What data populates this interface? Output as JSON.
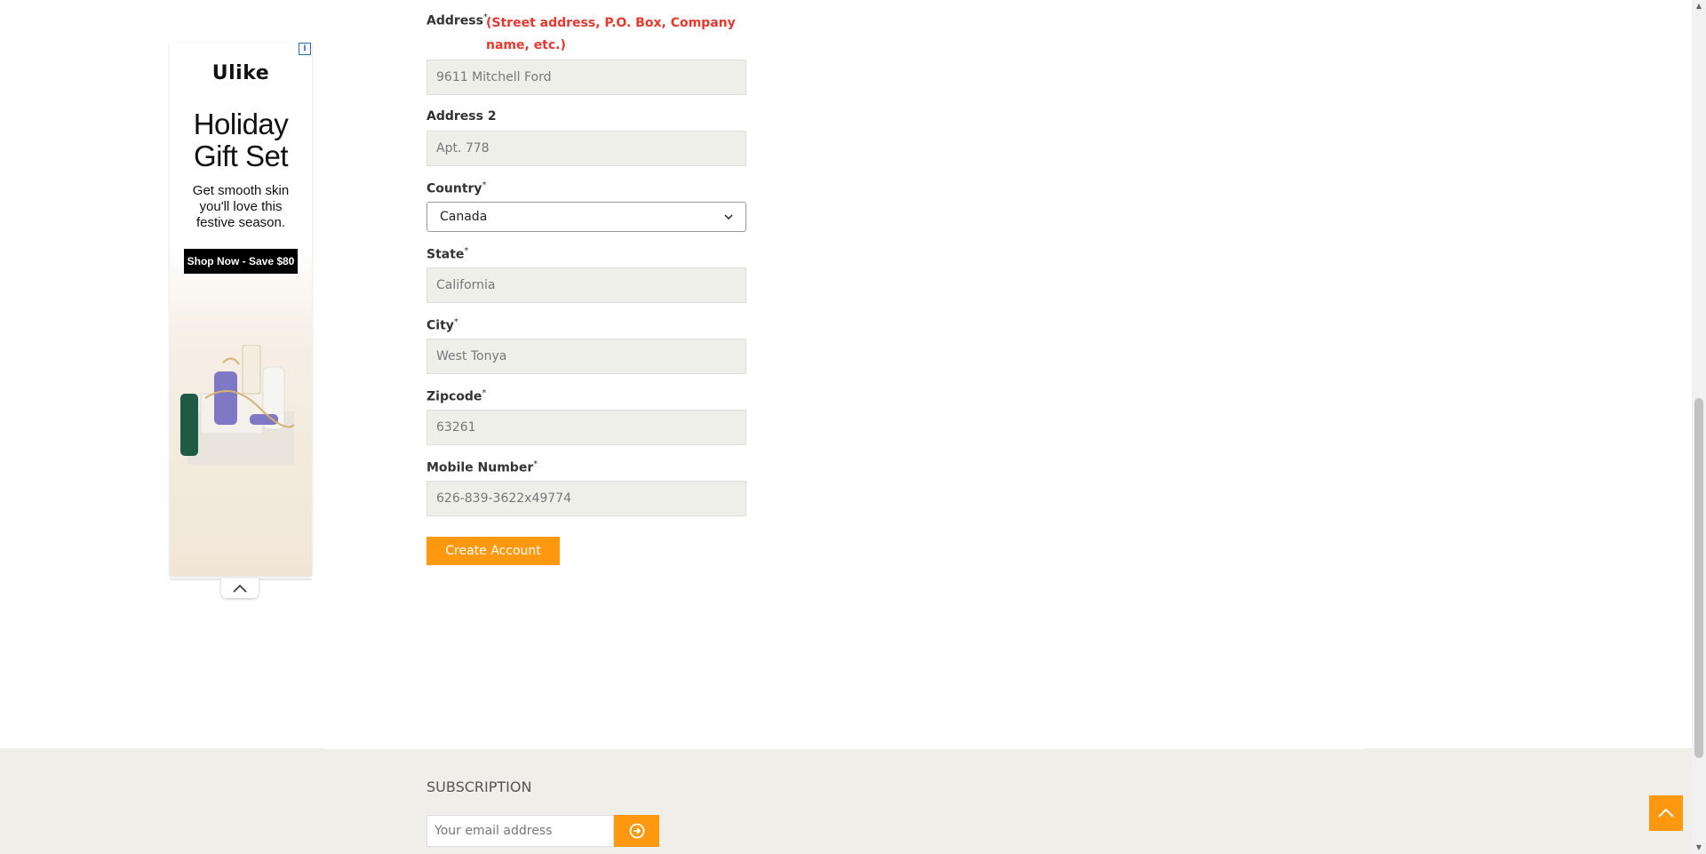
{
  "ad": {
    "info_icon": "i",
    "brand": "Ulike",
    "headline": "Holiday\nGift Set",
    "subtext": "Get smooth skin\nyou'll love this\nfestive season.",
    "cta": "Shop Now - Save $80"
  },
  "form": {
    "address": {
      "label": "Address",
      "required": "*",
      "hint": "(Street address, P.O. Box, Company name, etc.)",
      "value": "9611 Mitchell Ford"
    },
    "address2": {
      "label": "Address 2",
      "value": "Apt. 778"
    },
    "country": {
      "label": "Country",
      "required": "*",
      "selected": "Canada"
    },
    "state": {
      "label": "State",
      "required": "*",
      "value": "California"
    },
    "city": {
      "label": "City",
      "required": "*",
      "value": "West Tonya"
    },
    "zipcode": {
      "label": "Zipcode",
      "required": "*",
      "value": "63261"
    },
    "mobile": {
      "label": "Mobile Number",
      "required": "*",
      "value": "626-839-3622x49774"
    },
    "submit_label": "Create Account"
  },
  "footer": {
    "subscription_title": "SUBSCRIPTION",
    "email_placeholder": "Your email address"
  },
  "colors": {
    "accent": "#fe980f",
    "hint": "#e4392f",
    "footer_bg": "#efeee9"
  }
}
